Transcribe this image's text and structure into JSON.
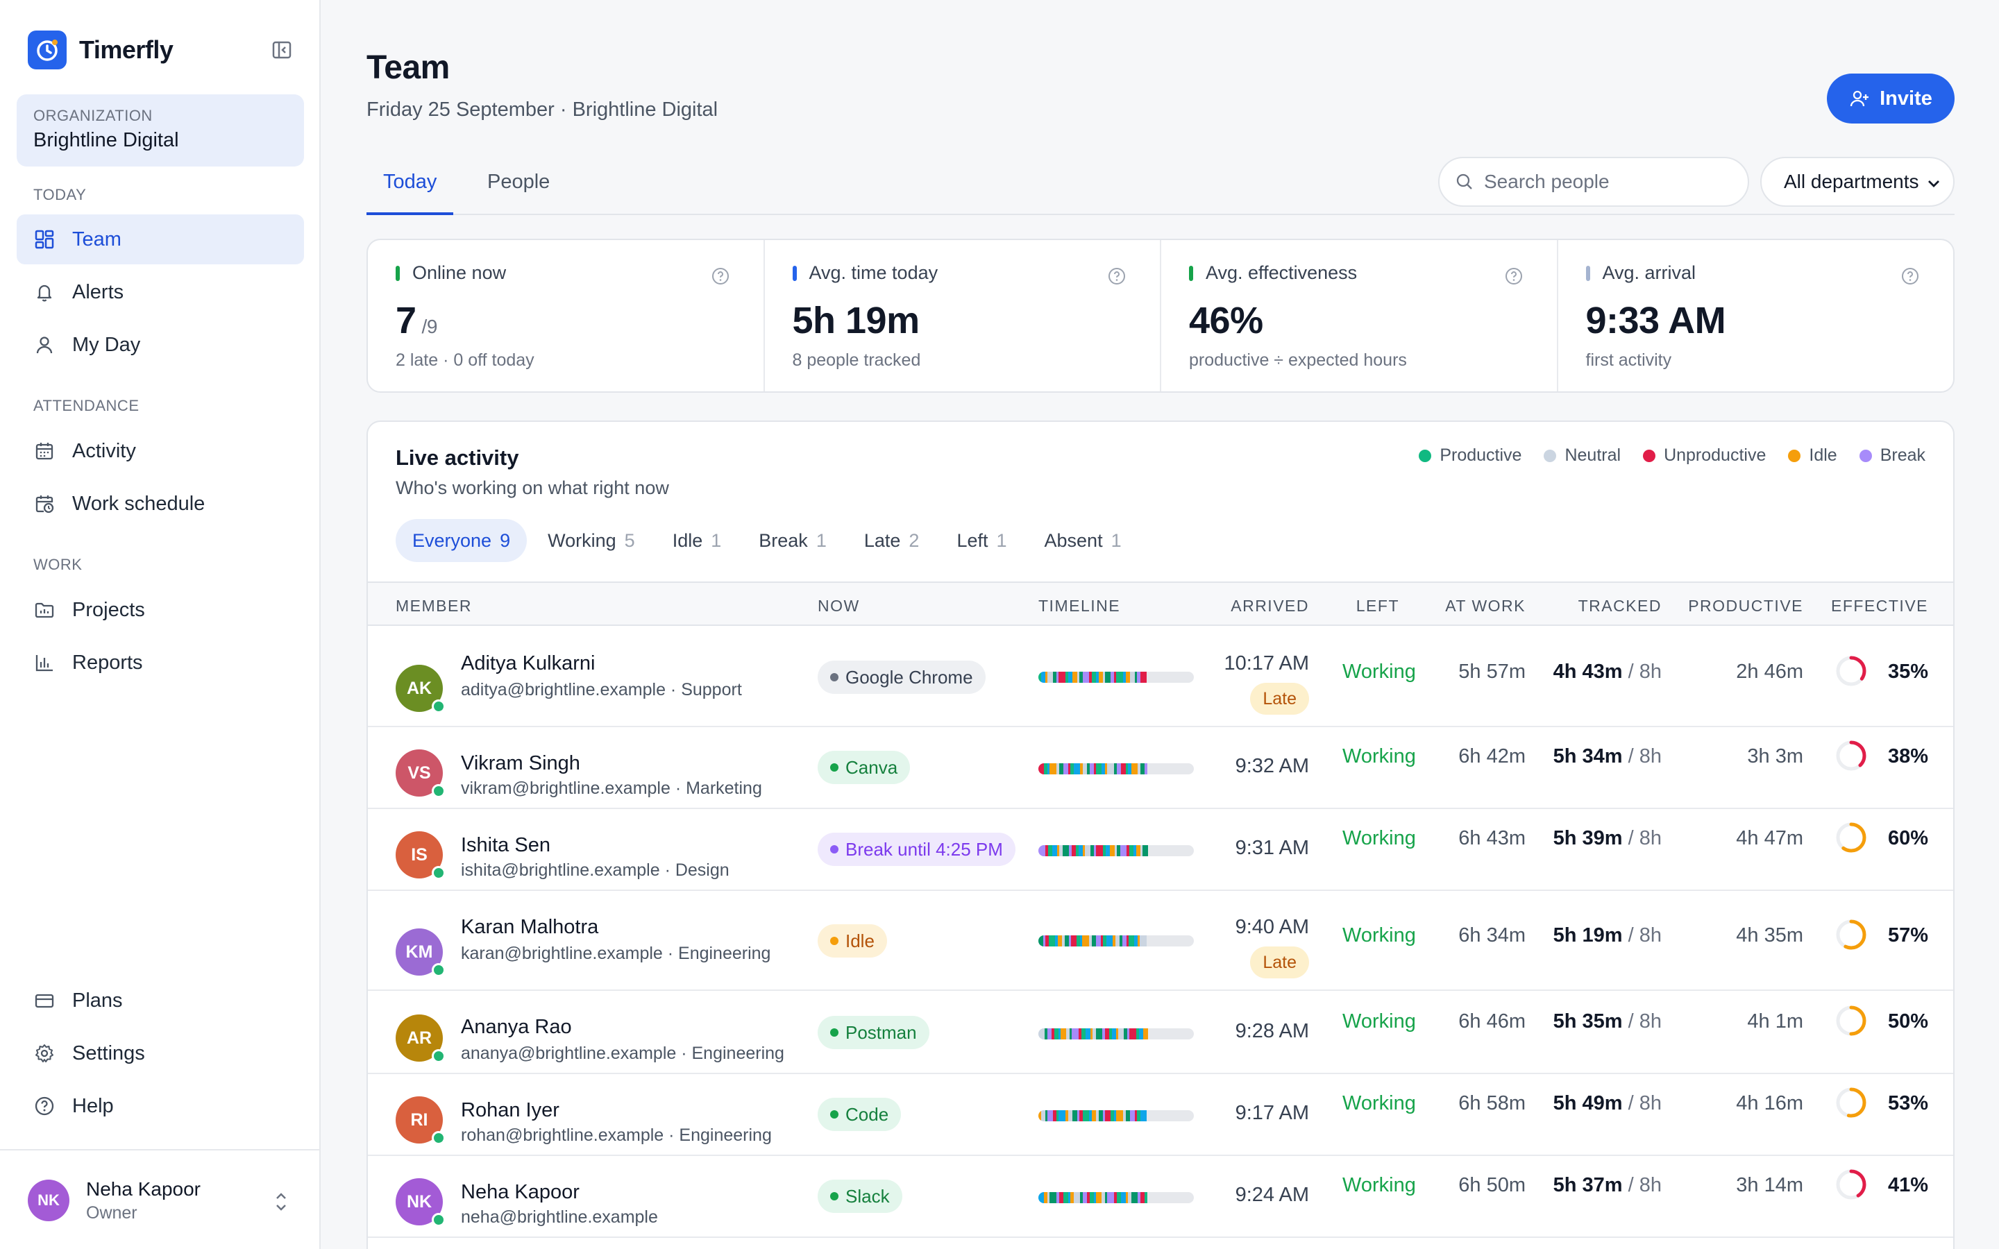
{
  "app": {
    "name": "Timerfly"
  },
  "sidebar": {
    "org_label": "ORGANIZATION",
    "org_name": "Brightline Digital",
    "sections": {
      "today": "TODAY",
      "attendance": "ATTENDANCE",
      "work": "WORK"
    },
    "items": {
      "team": "Team",
      "alerts": "Alerts",
      "my_day": "My Day",
      "activity": "Activity",
      "work_schedule": "Work schedule",
      "projects": "Projects",
      "reports": "Reports",
      "plans": "Plans",
      "settings": "Settings",
      "help": "Help"
    },
    "user": {
      "initials": "NK",
      "name": "Neha Kapoor",
      "role": "Owner"
    }
  },
  "header": {
    "title": "Team",
    "subtitle": "Friday 25 September · Brightline Digital",
    "invite_label": "Invite"
  },
  "tabs": {
    "today": "Today",
    "people": "People"
  },
  "search": {
    "placeholder": "Search people"
  },
  "department_filter": {
    "selected": "All departments"
  },
  "stats": {
    "online": {
      "label": "Online now",
      "value": "7",
      "of": "/9",
      "note": "2 late · 0 off today",
      "color": "#16a34a"
    },
    "avg_time": {
      "label": "Avg. time today",
      "value": "5h 19m",
      "note": "8 people tracked",
      "color": "#2563eb"
    },
    "effectiveness": {
      "label": "Avg. effectiveness",
      "value": "46%",
      "note": "productive ÷ expected hours",
      "color": "#16a34a"
    },
    "arrival": {
      "label": "Avg. arrival",
      "value": "9:33 AM",
      "note": "first activity",
      "color": "#a5b4d0"
    }
  },
  "live": {
    "title": "Live activity",
    "subtitle": "Who's working on what right now",
    "legend": [
      {
        "label": "Productive",
        "color": "#10b981"
      },
      {
        "label": "Neutral",
        "color": "#cbd5e1"
      },
      {
        "label": "Unproductive",
        "color": "#e11d48"
      },
      {
        "label": "Idle",
        "color": "#f59e0b"
      },
      {
        "label": "Break",
        "color": "#a78bfa"
      }
    ],
    "filters": [
      {
        "label": "Everyone",
        "count": "9"
      },
      {
        "label": "Working",
        "count": "5"
      },
      {
        "label": "Idle",
        "count": "1"
      },
      {
        "label": "Break",
        "count": "1"
      },
      {
        "label": "Late",
        "count": "2"
      },
      {
        "label": "Left",
        "count": "1"
      },
      {
        "label": "Absent",
        "count": "1"
      }
    ],
    "columns": {
      "member": "MEMBER",
      "now": "NOW",
      "timeline": "TIMELINE",
      "arrived": "ARRIVED",
      "left": "LEFT",
      "at_work": "AT WORK",
      "tracked": "TRACKED",
      "productive": "PRODUCTIVE",
      "effective": "EFFECTIVE"
    },
    "late_label": "Late",
    "rows": [
      {
        "initials": "AK",
        "avatar_color": "#6b8e23",
        "name": "Aditya Kulkarni",
        "email": "aditya@brightline.example · Support",
        "now": "Google Chrome",
        "now_kind": "neutral",
        "arrived": "10:17 AM",
        "late": true,
        "left": "Working",
        "at_work": "5h 57m",
        "tracked": "4h 43m",
        "expected": "/ 8h",
        "productive": "2h 46m",
        "effective": "35%",
        "effective_value": 0.35
      },
      {
        "initials": "VS",
        "avatar_color": "#cd5668",
        "name": "Vikram Singh",
        "email": "vikram@brightline.example · Marketing",
        "now": "Canva",
        "now_kind": "productive",
        "arrived": "9:32 AM",
        "late": false,
        "left": "Working",
        "at_work": "6h 42m",
        "tracked": "5h 34m",
        "expected": "/ 8h",
        "productive": "3h 3m",
        "effective": "38%",
        "effective_value": 0.38
      },
      {
        "initials": "IS",
        "avatar_color": "#d9603e",
        "name": "Ishita Sen",
        "email": "ishita@brightline.example · Design",
        "now": "Break until 4:25 PM",
        "now_kind": "break",
        "arrived": "9:31 AM",
        "late": false,
        "left": "Working",
        "at_work": "6h 43m",
        "tracked": "5h 39m",
        "expected": "/ 8h",
        "productive": "4h 47m",
        "effective": "60%",
        "effective_value": 0.6
      },
      {
        "initials": "KM",
        "avatar_color": "#9b6bd4",
        "name": "Karan Malhotra",
        "email": "karan@brightline.example · Engineering",
        "now": "Idle",
        "now_kind": "idle",
        "arrived": "9:40 AM",
        "late": true,
        "left": "Working",
        "at_work": "6h 34m",
        "tracked": "5h 19m",
        "expected": "/ 8h",
        "productive": "4h 35m",
        "effective": "57%",
        "effective_value": 0.57
      },
      {
        "initials": "AR",
        "avatar_color": "#b7860b",
        "name": "Ananya Rao",
        "email": "ananya@brightline.example · Engineering",
        "now": "Postman",
        "now_kind": "productive",
        "arrived": "9:28 AM",
        "late": false,
        "left": "Working",
        "at_work": "6h 46m",
        "tracked": "5h 35m",
        "expected": "/ 8h",
        "productive": "4h 1m",
        "effective": "50%",
        "effective_value": 0.5
      },
      {
        "initials": "RI",
        "avatar_color": "#d9603e",
        "name": "Rohan Iyer",
        "email": "rohan@brightline.example · Engineering",
        "now": "Code",
        "now_kind": "productive",
        "arrived": "9:17 AM",
        "late": false,
        "left": "Working",
        "at_work": "6h 58m",
        "tracked": "5h 49m",
        "expected": "/ 8h",
        "productive": "4h 16m",
        "effective": "53%",
        "effective_value": 0.53
      },
      {
        "initials": "NK",
        "avatar_color": "#a35bd6",
        "name": "Neha Kapoor",
        "email": "neha@brightline.example",
        "now": "Slack",
        "now_kind": "productive",
        "arrived": "9:24 AM",
        "late": false,
        "left": "Working",
        "at_work": "6h 50m",
        "tracked": "5h 37m",
        "expected": "/ 8h",
        "productive": "3h 14m",
        "effective": "41%",
        "effective_value": 0.41
      }
    ]
  }
}
